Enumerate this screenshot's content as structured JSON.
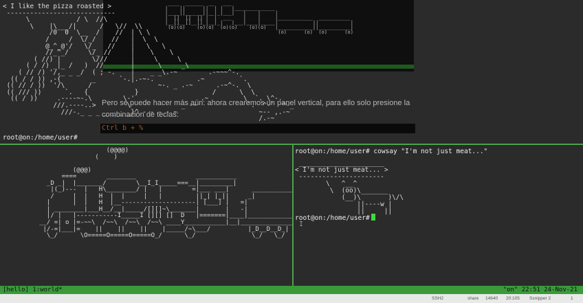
{
  "top_pane": {
    "cow_art": "< I like the pizza roasted >\n ----------------------------\n      \\            / \\  //\\\n       \\    |\\___/|      /   \\//  \\\\\n            /0  0  \\__  /    //  | \\ \\\n           /     /  \\/_/    //   |  \\  \\\n           @_^_@'/   \\/_   //    |   \\   \\\n           //_^_/     \\/_ //     |    \\    \\\n        ( //) |        \\///      |     \\     \\\n      ( / /) _|_ /   )  //       |      \\     _\\\n    ( // /) '/,_ _ _/  ( ; -.    |    _ _\\.-~        .-~~~^-.\n  (( / / )) ,-{        _      `-.|.-~-.           .~         `.\n (( // / ))  '/\\      /                 ~-. _ .-~      .-~^-.  \\\n (( /// ))      `.   {            }                   /      \\  \\\n  (( / ))     .----~-.\\        \\-'                 .~         \\  `. \\^-.\n             ///.----..>        \\             _ -~             `.  ^-`  ^-_\n               ///-._ _ _ _ _ _ _}^ - - - - ~                     ~-- ,.-~\n                                                                  /.-~",
    "prompt": "root@on:/home/user#",
    "overlay_text": "Pero se puede hacer más aún: ahora crearemos un panel vertical, para ello solo presione la combinación de teclas:",
    "overlay_cmd": "Ctrl b + %",
    "overlay_train": " ____  ______  __   ___\n|    ||      ||  | |   |______________\n|____||______||__|_|___|   |    |     |\n|  []  []  [] |  |  ___    |    |     |____________  ___________\n|__[]__[]__[]_|__|_|   |___|____|_____|            ||           |\n (o)(o)    (o)(o)  (o)(o)    (o)(o)   |____________||___________|\n                                       (o)      (o)  (o)      (o)"
  },
  "bottom_left_pane": {
    "train_art": "                       (@@@@)\n                    (    )\n\n              (@@@)\n           ====        ________                ___________\n       _D _|  |_______/        \\__I_I_____===__|_________|\n        |(_)---  |   H\\________/ |   |        =|___ ___|      _________________\n        /     |  |   H  |  |     |   |         ||_| |_||     _|                \\_____A\n       |      |  |   H  |__--------------------| [___] |   =|                        |\n       | ________|___H__/__|_____/[][]~\\_______|       |   -|                        |\n       |/ |   |-----------I_____I [][] []  D   |=======|____|________________________|_\n     __/ =| o |=-~~\\  /~~\\  /~~\\  /~~\\ ____Y___________|__|__________________________|_\n      |/-=|___|=    ||    ||    ||    |_____/~\\___/          |_D__D__D_|  |_D__D__D_|\n       \\_/      \\O=====O=====O=====O_/      \\_/               \\_/   \\_/    \\_/   \\_/"
  },
  "bottom_right_pane": {
    "command_line": "root@on:/home/user# cowsay \"I'm not just meat...\"",
    "cow_art": " ______________________\n< I'm not just meat... >\n ----------------------\n        \\   ^__^\n         \\  (oo)\\_______\n            (__)\\       )\\/\\\n                ||----w |\n                ||     ||",
    "prompt": "root@on:/home/user#"
  },
  "status_bar": {
    "left": "[hello] 1:world*",
    "right": "\"on\" 22:51 24-Nov-21"
  },
  "taskbar": {
    "items": [
      "SSH2",
      "share",
      "14640",
      "20:105",
      "Ssnipper 2",
      "1"
    ]
  },
  "colors": {
    "background": "#2b2b2b",
    "divider": "#4ba24b",
    "status_bar": "#3a9a3a",
    "cursor": "#3fd83f"
  }
}
